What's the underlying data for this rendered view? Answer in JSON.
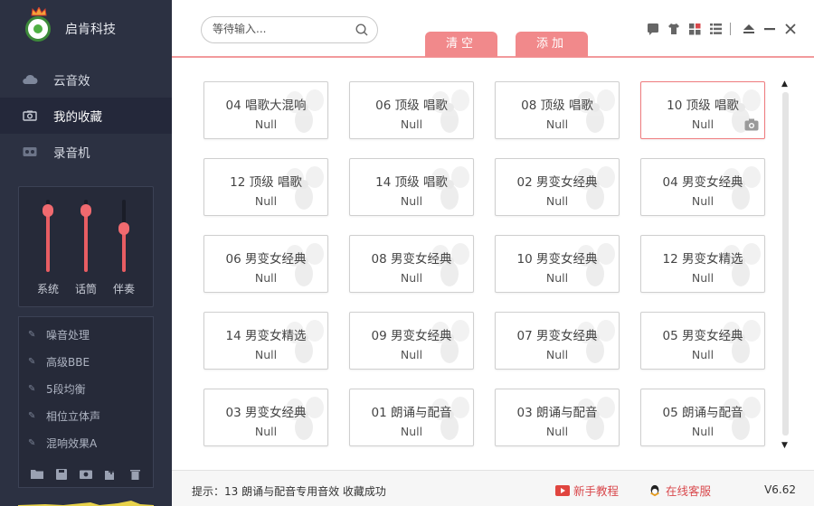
{
  "app": {
    "name": "启肯科技"
  },
  "colors": {
    "accent": "#f1898b",
    "sidebar_bg": "#2c3142",
    "slider": "#e85d63",
    "link": "#d9484c"
  },
  "nav": [
    {
      "label": "云音效",
      "icon": "cloud-icon"
    },
    {
      "label": "我的收藏",
      "icon": "camera-icon"
    },
    {
      "label": "录音机",
      "icon": "recorder-icon"
    }
  ],
  "mixer": {
    "sliders": [
      {
        "label": "系统",
        "level": 0.85
      },
      {
        "label": "话筒",
        "level": 0.85
      },
      {
        "label": "伴奏",
        "level": 0.6
      }
    ]
  },
  "effects": [
    "噪音处理",
    "高级BBE",
    "5段均衡",
    "相位立体声",
    "混响效果A"
  ],
  "search": {
    "placeholder": "等待输入..."
  },
  "toolbar": {
    "clear_label": "清空",
    "add_label": "添加"
  },
  "cards": [
    {
      "title": "04 唱歌大混响",
      "sub": "Null"
    },
    {
      "title": "06 顶级 唱歌",
      "sub": "Null"
    },
    {
      "title": "08 顶级 唱歌",
      "sub": "Null"
    },
    {
      "title": "10 顶级 唱歌",
      "sub": "Null"
    },
    {
      "title": "12 顶级 唱歌",
      "sub": "Null"
    },
    {
      "title": "14 顶级 唱歌",
      "sub": "Null"
    },
    {
      "title": "02 男变女经典",
      "sub": "Null"
    },
    {
      "title": "04 男变女经典",
      "sub": "Null"
    },
    {
      "title": "06 男变女经典",
      "sub": "Null"
    },
    {
      "title": "08 男变女经典",
      "sub": "Null"
    },
    {
      "title": "10 男变女经典",
      "sub": "Null"
    },
    {
      "title": "12 男变女精选",
      "sub": "Null"
    },
    {
      "title": "14 男变女精选",
      "sub": "Null"
    },
    {
      "title": "09 男变女经典",
      "sub": "Null"
    },
    {
      "title": "07 男变女经典",
      "sub": "Null"
    },
    {
      "title": "05 男变女经典",
      "sub": "Null"
    },
    {
      "title": "03 男变女经典",
      "sub": "Null"
    },
    {
      "title": "01 朗诵与配音",
      "sub": "Null"
    },
    {
      "title": "03 朗诵与配音",
      "sub": "Null"
    },
    {
      "title": "05 朗诵与配音",
      "sub": "Null"
    }
  ],
  "status": {
    "message": "提示：13 朗诵与配音专用音效 收藏成功",
    "tutorial_label": "新手教程",
    "support_label": "在线客服",
    "version": "V6.62"
  }
}
